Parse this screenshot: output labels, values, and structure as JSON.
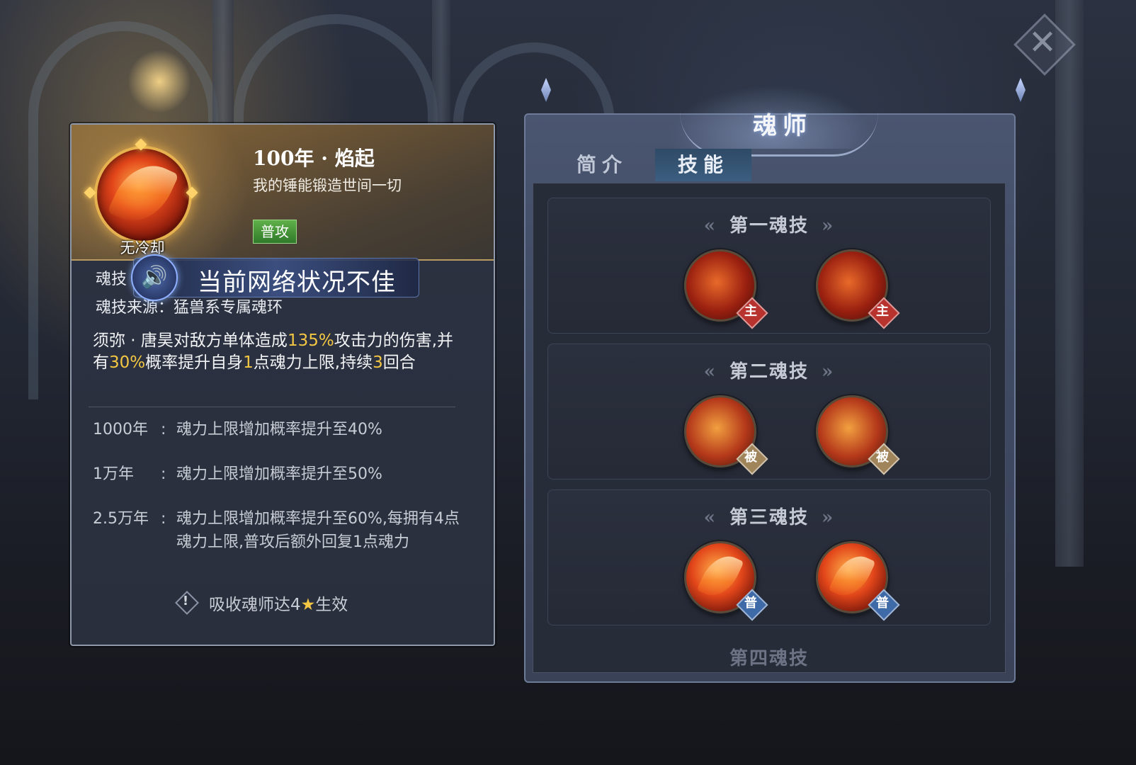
{
  "skill_card": {
    "title": "100年 · 焰起",
    "subtitle": "我的锤能锻造世间一切",
    "cooldown": "无冷却",
    "tag": "普攻",
    "soul_skill_label": "魂技",
    "source_label": "魂技来源：",
    "source_value": "猛兽系专属魂环",
    "description": {
      "p1": "须弥 · 唐昊对敌方单体造成",
      "v1": "135%",
      "p2": "攻击力的伤害,并有",
      "v2": "30%",
      "p3": "概率提升自身",
      "v3": "1",
      "p4": "点魂力上限,持续",
      "v4": "3",
      "p5": "回合"
    },
    "levels": [
      {
        "level": "1000年",
        "text": "魂力上限增加概率提升至40%"
      },
      {
        "level": "1万年",
        "text": "魂力上限增加概率提升至50%"
      },
      {
        "level": "2.5万年",
        "text": "魂力上限增加概率提升至60%,每拥有4点魂力上限,普攻后额外回复1点魂力"
      }
    ],
    "condition": {
      "prefix": "吸收魂师达4",
      "suffix": "生效"
    }
  },
  "network_toast": {
    "text": "当前网络状况不佳",
    "icon": "speaker-icon"
  },
  "panel": {
    "title": "魂师",
    "tabs": [
      {
        "label": "简介"
      },
      {
        "label": "技能"
      }
    ],
    "active_tab": "技能",
    "sections": [
      {
        "title": "第一魂技",
        "skills": [
          {
            "badge": "主"
          },
          {
            "badge": "主"
          }
        ]
      },
      {
        "title": "第二魂技",
        "skills": [
          {
            "badge": "被"
          },
          {
            "badge": "被"
          }
        ]
      },
      {
        "title": "第三魂技",
        "skills": [
          {
            "badge": "普"
          },
          {
            "badge": "普"
          }
        ]
      }
    ],
    "next_section_peek": "第四魂技"
  },
  "colors": {
    "highlight": "#f3c743",
    "tag_green": "#4a9a3a",
    "badge_main": "#b8322e",
    "badge_passive": "#a0845a",
    "badge_normal": "#3f6aa8"
  }
}
